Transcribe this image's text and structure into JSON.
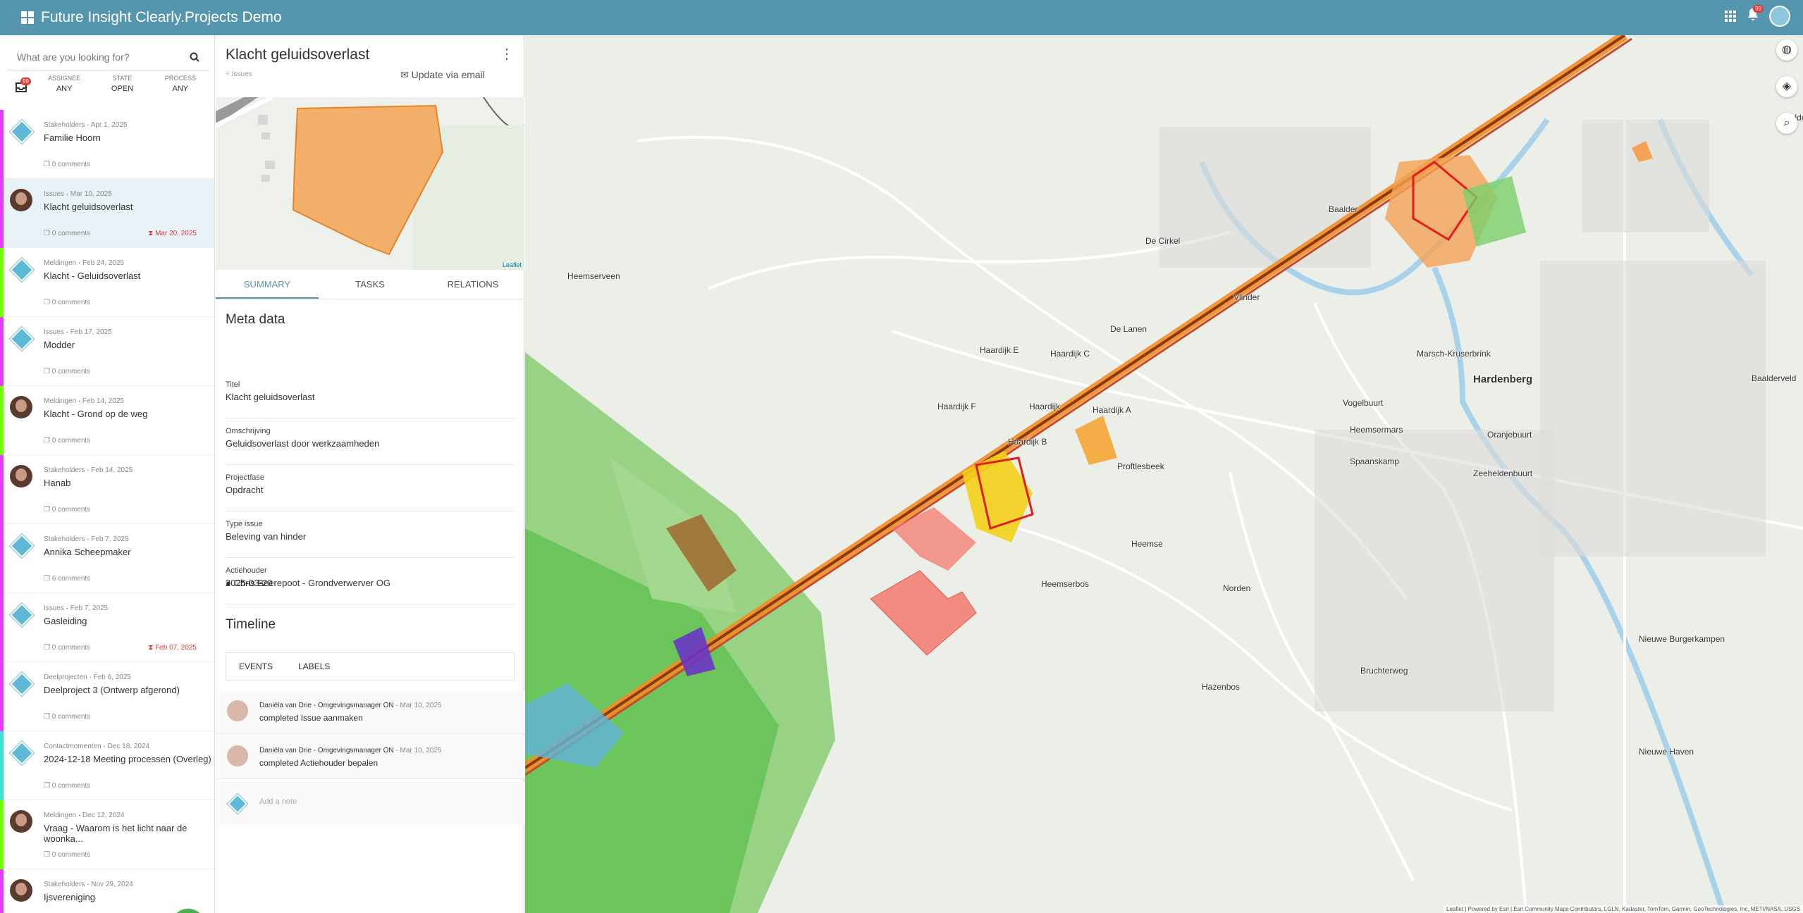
{
  "app": {
    "title": "Future Insight Clearly.Projects Demo",
    "notif_count": "99"
  },
  "sidebar": {
    "search_placeholder": "What are you looking for?",
    "inbox_count": "99",
    "filters": [
      {
        "label": "ASSIGNEE",
        "value": "ANY"
      },
      {
        "label": "STATE",
        "value": "OPEN"
      },
      {
        "label": "PROCESS",
        "value": "ANY"
      }
    ],
    "items": [
      {
        "type": "Stakeholders",
        "date": "Apr 1, 2025",
        "name": "Familie Hoorn",
        "comments": "0 comments",
        "due": "",
        "avatar": "diamond",
        "stripe": "#e040fb"
      },
      {
        "type": "Issues",
        "date": "Mar 10, 2025",
        "name": "Klacht geluidsoverlast",
        "comments": "0 comments",
        "due": "Mar 20, 2025",
        "avatar": "person",
        "stripe": "#e040fb"
      },
      {
        "type": "Meldingen",
        "date": "Feb 24, 2025",
        "name": "Klacht - Geluidsoverlast",
        "comments": "0 comments",
        "due": "",
        "avatar": "diamond",
        "stripe": "#76ff03"
      },
      {
        "type": "Issues",
        "date": "Feb 17, 2025",
        "name": "Modder",
        "comments": "0 comments",
        "due": "",
        "avatar": "diamond",
        "stripe": "#e040fb"
      },
      {
        "type": "Meldingen",
        "date": "Feb 14, 2025",
        "name": "Klacht - Grond op de weg",
        "comments": "0 comments",
        "due": "",
        "avatar": "person",
        "stripe": "#76ff03"
      },
      {
        "type": "Stakeholders",
        "date": "Feb 14, 2025",
        "name": "Hanab",
        "comments": "0 comments",
        "due": "",
        "avatar": "person",
        "stripe": "#e040fb"
      },
      {
        "type": "Stakeholders",
        "date": "Feb 7, 2025",
        "name": "Annika Scheepmaker",
        "comments": "6 comments",
        "due": "",
        "avatar": "diamond",
        "stripe": "#e040fb"
      },
      {
        "type": "Issues",
        "date": "Feb 7, 2025",
        "name": "Gasleiding",
        "comments": "0 comments",
        "due": "Feb 07, 2025",
        "avatar": "diamond",
        "stripe": "#e040fb"
      },
      {
        "type": "Deelprojecten",
        "date": "Feb 6, 2025",
        "name": "Deelproject 3 (Ontwerp afgerond)",
        "comments": "0 comments",
        "due": "",
        "avatar": "diamond",
        "stripe": "#e040fb"
      },
      {
        "type": "Contactmomenten",
        "date": "Dec 18, 2024",
        "name": "2024-12-18 Meeting processen (Overleg)",
        "comments": "0 comments",
        "due": "",
        "avatar": "diamond",
        "stripe": "#40e0d0"
      },
      {
        "type": "Meldingen",
        "date": "Dec 12, 2024",
        "name": "Vraag - Waarom is het licht naar de woonka...",
        "comments": "0 comments",
        "due": "",
        "avatar": "person",
        "stripe": "#76ff03"
      },
      {
        "type": "Stakeholders",
        "date": "Nov 29, 2024",
        "name": "Ijsvereniging",
        "comments": "",
        "due": "",
        "avatar": "person",
        "stripe": "#e040fb"
      }
    ]
  },
  "detail": {
    "title": "Klacht geluidsoverlast",
    "category": "Issues",
    "update_email": "Update via email",
    "minimap_attr": "Leaflet",
    "tabs": [
      "SUMMARY",
      "TASKS",
      "RELATIONS"
    ],
    "meta_heading": "Meta data",
    "fields": [
      {
        "label": "Titel",
        "value": "Klacht geluidsoverlast"
      },
      {
        "label": "Omschrijving",
        "value": "Geluidsoverlast door werkzaamheden"
      },
      {
        "label": "Projectfase",
        "value": "Opdracht"
      },
      {
        "label": "Type issue",
        "value": "Beleving van hinder"
      },
      {
        "label": "Actiehouder",
        "value": "Chris Beerepoot - Grondverwerver OG"
      }
    ],
    "date": "2025-03-20",
    "timeline_heading": "Timeline",
    "timeline_tabs": [
      "EVENTS",
      "LABELS"
    ],
    "events": [
      {
        "who": "Daniëla van Drie - Omgevingsmanager ON",
        "date": "Mar 10, 2025",
        "action": "completed",
        "task": "Issue aanmaken"
      },
      {
        "who": "Daniëla van Drie - Omgevingsmanager ON",
        "date": "Mar 10, 2025",
        "action": "completed",
        "task": "Actiehouder bepalen"
      }
    ],
    "note_placeholder": "Add a note"
  },
  "map": {
    "labels": [
      "Heemserveen",
      "De Cirkel",
      "Vlinder",
      "De Lanen",
      "Haardijk E",
      "Haardijk C",
      "Haardijk F",
      "Haardijk",
      "Haardijk A",
      "Haardijk B",
      "Marsch-Kruserbrink",
      "Hardenberg",
      "Vogelbuurt",
      "Heemsermars",
      "Oranjebuurt",
      "Spaanskamp",
      "Zeeheldenbuurt",
      "Heemse",
      "Heemserbos",
      "Norden",
      "Hazenbos",
      "Bruchterweg",
      "Nieuwe Burgerkampen",
      "Nieuwe Haven",
      "Baalder",
      "Baalder-Esch",
      "Baalderveld",
      "Proftlesbeek"
    ],
    "attribution": "Leaflet | Powered by Esri | Esri Community Maps Contributors, LGLN, Kadaster, TomTom, Garmin, GeoTechnologies, Inc, METI/NASA, USGS"
  }
}
